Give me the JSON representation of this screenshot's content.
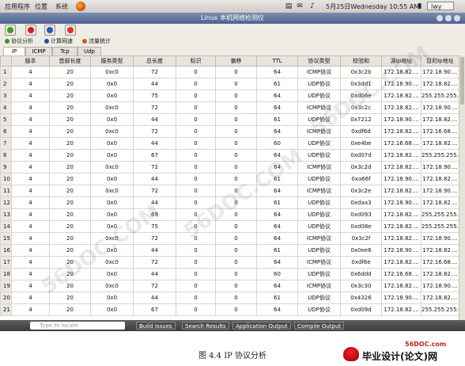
{
  "topbar": {
    "menu_apps": "应用程序",
    "menu_places": "位置",
    "menu_system": "系统",
    "datetime": "5月25日Wednesday 10:55 AM",
    "user": "lwy"
  },
  "window": {
    "title": "Linux 本机网络检测仪"
  },
  "nav_tabs": [
    {
      "label": "协议分析",
      "color": "#3f8f2a"
    },
    {
      "label": "计算网速",
      "color": "#2a4b9e"
    },
    {
      "label": "流量统计",
      "color": "#d8561b"
    }
  ],
  "protocol_tabs": [
    "IP",
    "ICMP",
    "Tcp",
    "Udp"
  ],
  "table": {
    "columns": [
      "",
      "版本",
      "首部长度",
      "服务类型",
      "总长度",
      "标识",
      "偏移",
      "TTL",
      "协议类型",
      "校验和",
      "源Ip地址",
      "目的Ip地址"
    ],
    "rows": [
      [
        "1",
        "4",
        "20",
        "0xc0",
        "72",
        "0",
        "0",
        "64",
        "ICMP协议",
        "0x3c2b",
        "172.18.82....",
        "172.18.90...."
      ],
      [
        "2",
        "4",
        "20",
        "0x0",
        "44",
        "0",
        "0",
        "61",
        "UDP协议",
        "0x3dd1",
        "172.18.90....",
        "172.18.82...."
      ],
      [
        "3",
        "4",
        "20",
        "0x0",
        "75",
        "0",
        "0",
        "64",
        "UDP协议",
        "0xd06e",
        "172.18.82....",
        "255.255.255...."
      ],
      [
        "4",
        "4",
        "20",
        "0xc0",
        "72",
        "0",
        "0",
        "64",
        "ICMP协议",
        "0x3c2c",
        "172.18.82....",
        "172.18.90...."
      ],
      [
        "5",
        "4",
        "20",
        "0x0",
        "44",
        "0",
        "0",
        "61",
        "UDP协议",
        "0x7212",
        "172.18.90....",
        "172.18.82...."
      ],
      [
        "6",
        "4",
        "20",
        "0xc0",
        "72",
        "0",
        "0",
        "64",
        "ICMP协议",
        "0xdf6d",
        "172.18.82....",
        "172.16.68...."
      ],
      [
        "7",
        "4",
        "20",
        "0x0",
        "44",
        "0",
        "0",
        "60",
        "UDP协议",
        "0xe4be",
        "172.16.68....",
        "172.18.82...."
      ],
      [
        "8",
        "4",
        "20",
        "0x0",
        "67",
        "0",
        "0",
        "64",
        "UDP协议",
        "0xd07d",
        "172.18.82....",
        "255.255.255...."
      ],
      [
        "9",
        "4",
        "20",
        "0xc0",
        "72",
        "0",
        "0",
        "64",
        "ICMP协议",
        "0x3c2d",
        "172.18.82....",
        "172.18.90...."
      ],
      [
        "10",
        "4",
        "20",
        "0x0",
        "44",
        "0",
        "0",
        "61",
        "UDP协议",
        "0xa66f",
        "172.18.90....",
        "172.18.82...."
      ],
      [
        "11",
        "4",
        "20",
        "0xc0",
        "72",
        "0",
        "0",
        "64",
        "ICMP协议",
        "0x3c2e",
        "172.18.82....",
        "172.18.90...."
      ],
      [
        "12",
        "4",
        "20",
        "0x0",
        "44",
        "0",
        "0",
        "61",
        "UDP协议",
        "0xdaa3",
        "172.18.90....",
        "172.18.82...."
      ],
      [
        "13",
        "4",
        "20",
        "0x0",
        "69",
        "0",
        "0",
        "64",
        "UDP协议",
        "0xd093",
        "172.18.82....",
        "255.255.255...."
      ],
      [
        "14",
        "4",
        "20",
        "0x0",
        "75",
        "0",
        "0",
        "64",
        "UDP协议",
        "0xd08e",
        "172.18.82....",
        "255.255.255...."
      ],
      [
        "15",
        "4",
        "20",
        "0xc0",
        "72",
        "0",
        "0",
        "64",
        "ICMP协议",
        "0x3c2f",
        "172.18.82....",
        "172.18.90...."
      ],
      [
        "16",
        "4",
        "20",
        "0x0",
        "44",
        "0",
        "0",
        "61",
        "UDP协议",
        "0x0ee6",
        "172.18.90....",
        "172.18.82...."
      ],
      [
        "17",
        "4",
        "20",
        "0xc0",
        "72",
        "0",
        "0",
        "64",
        "ICMP协议",
        "0xdf6e",
        "172.18.82....",
        "172.16.68...."
      ],
      [
        "18",
        "4",
        "20",
        "0x0",
        "44",
        "0",
        "0",
        "60",
        "UDP协议",
        "0x6ddd",
        "172.16.68....",
        "172.18.82...."
      ],
      [
        "19",
        "4",
        "20",
        "0xc0",
        "72",
        "0",
        "0",
        "64",
        "ICMP协议",
        "0x3c30",
        "172.18.82....",
        "172.18.90...."
      ],
      [
        "20",
        "4",
        "20",
        "0x0",
        "44",
        "0",
        "0",
        "61",
        "UDP协议",
        "0x4326",
        "172.18.90....",
        "172.18.82...."
      ],
      [
        "21",
        "4",
        "20",
        "0x0",
        "67",
        "0",
        "0",
        "64",
        "UDP协议",
        "0xd09d",
        "172.18.82....",
        "255.255.255...."
      ]
    ]
  },
  "bottom_panel": {
    "search_placeholder": "Type to locate",
    "tabs": [
      "Build Issues",
      "Search Results",
      "Application Output",
      "Compile Output"
    ]
  },
  "caption": "图 4.4 IP 协议分析",
  "branding": {
    "url": "56DOC.com",
    "name": "毕业设计(论文)网"
  },
  "watermark_text": "56DOC.COM"
}
